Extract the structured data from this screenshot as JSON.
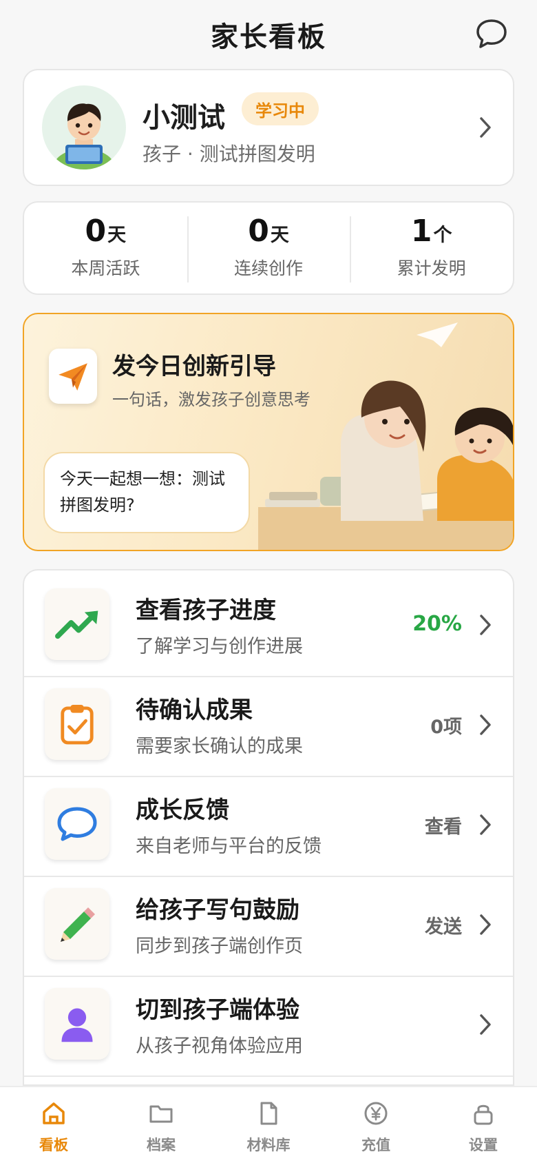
{
  "header": {
    "title": "家长看板",
    "message_icon": "chat-bubble-icon"
  },
  "profile": {
    "name": "小测试",
    "badge": "学习中",
    "subtitle": "孩子 · 测试拼图发明",
    "avatar_icon": "child-avatar"
  },
  "stats": [
    {
      "value": "0",
      "unit": "天",
      "label": "本周活跃"
    },
    {
      "value": "0",
      "unit": "天",
      "label": "连续创作"
    },
    {
      "value": "1",
      "unit": "个",
      "label": "累计发明"
    }
  ],
  "banner": {
    "title": "发今日创新引导",
    "subtitle": "一句话，激发孩子创意思考",
    "prompt": "今天一起想一想：测试拼图发明?",
    "icon": "paper-plane-icon"
  },
  "menu": [
    {
      "title": "查看孩子进度",
      "subtitle": "了解学习与创作进展",
      "value": "20%",
      "icon": "trend-up-icon"
    },
    {
      "title": "待确认成果",
      "subtitle": "需要家长确认的成果",
      "value": "0项",
      "icon": "clipboard-check-icon"
    },
    {
      "title": "成长反馈",
      "subtitle": "来自老师与平台的反馈",
      "value": "查看",
      "icon": "speech-bubble-icon"
    },
    {
      "title": "给孩子写句鼓励",
      "subtitle": "同步到孩子端创作页",
      "value": "发送",
      "icon": "pencil-icon"
    },
    {
      "title": "切到孩子端体验",
      "subtitle": "从孩子视角体验应用",
      "value": "",
      "icon": "user-icon"
    }
  ],
  "tabs": [
    {
      "label": "看板",
      "icon": "home-icon",
      "active": true
    },
    {
      "label": "档案",
      "icon": "folder-icon"
    },
    {
      "label": "材料库",
      "icon": "document-icon"
    },
    {
      "label": "充值",
      "icon": "yen-coin-icon"
    },
    {
      "label": "设置",
      "icon": "lock-icon"
    }
  ],
  "colors": {
    "accent": "#e8880a",
    "progress": "#28a745",
    "banner_border": "#f1a425"
  }
}
